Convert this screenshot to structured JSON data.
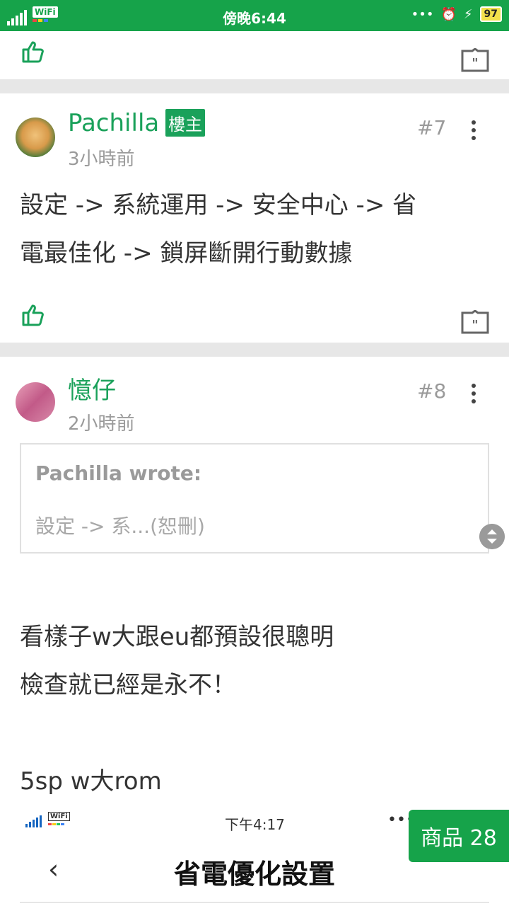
{
  "status_bar": {
    "time": "傍晚6:44",
    "wifi_label": "WiFi",
    "battery": "97"
  },
  "posts": [
    {
      "floor": "#7",
      "username": "Pachilla",
      "op_badge": "樓主",
      "time_ago": "3小時前",
      "body_lines": [
        "設定 -> 系統運用 -> 安全中心 -> 省",
        "電最佳化 -> 鎖屏斷開行動數據"
      ]
    },
    {
      "floor": "#8",
      "username": "憶仔",
      "time_ago": "2小時前",
      "quote": {
        "author": "Pachilla wrote:",
        "text": "設定 -> 系...(恕刪)"
      },
      "body_lines": [
        "看樣子w大跟eu都預設很聰明",
        "檢查就已經是永不！",
        "",
        "5sp w大rom"
      ]
    }
  ],
  "embedded_screenshot": {
    "time": "下午4:17",
    "title": "省電優化設置",
    "back_icon": "‹",
    "wifi_label": "WiFi",
    "menu_dots": "•••"
  },
  "product_button": {
    "label": "商品 28"
  },
  "colors": {
    "accent": "#1aa15a",
    "status_bar": "#16a34a"
  },
  "icons": [
    "signal-icon",
    "wifi-icon",
    "alarm-icon",
    "charging-icon",
    "battery-icon",
    "thumbs-up-icon",
    "quote-reply-icon",
    "more-vert-icon",
    "scroll-handle-icon",
    "back-chevron-icon"
  ]
}
